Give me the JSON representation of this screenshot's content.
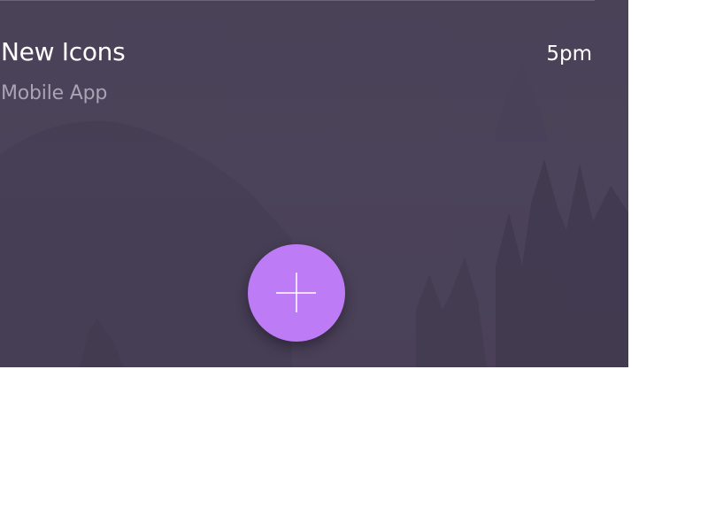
{
  "card": {
    "title": "New Icons",
    "subtitle": "Mobile App",
    "time": "5pm",
    "background_color": "#4a4257"
  },
  "fab": {
    "icon": "plus-icon",
    "color": "#bd7cf5"
  }
}
